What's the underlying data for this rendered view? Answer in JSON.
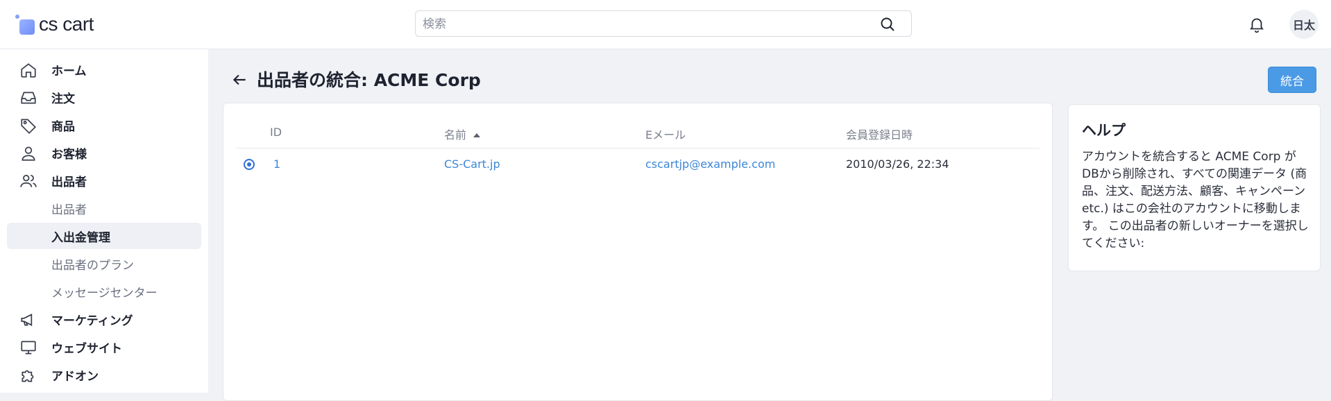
{
  "app": {
    "logo_text": "cs cart"
  },
  "search": {
    "placeholder": "検索"
  },
  "user": {
    "avatar_text": "日太"
  },
  "sidebar": {
    "items": [
      {
        "label": "ホーム",
        "icon": "home-icon"
      },
      {
        "label": "注文",
        "icon": "inbox-icon"
      },
      {
        "label": "商品",
        "icon": "tag-icon"
      },
      {
        "label": "お客様",
        "icon": "user-icon"
      },
      {
        "label": "出品者",
        "icon": "users-icon"
      }
    ],
    "subitems": [
      {
        "label": "出品者"
      },
      {
        "label": "入出金管理",
        "active": true
      },
      {
        "label": "出品者のプラン"
      },
      {
        "label": "メッセージセンター"
      }
    ],
    "items_after": [
      {
        "label": "マーケティング",
        "icon": "megaphone-icon"
      },
      {
        "label": "ウェブサイト",
        "icon": "monitor-icon"
      },
      {
        "label": "アドオン",
        "icon": "puzzle-icon"
      }
    ]
  },
  "page": {
    "title": "出品者の統合: ACME Corp",
    "merge_button": "統合"
  },
  "table": {
    "headers": {
      "id": "ID",
      "name": "名前",
      "email": "Eメール",
      "registered": "会員登録日時"
    },
    "rows": [
      {
        "id": "1",
        "name": "CS-Cart.jp",
        "email": "cscartjp@example.com",
        "registered": "2010/03/26, 22:34",
        "selected": true
      }
    ]
  },
  "help": {
    "title": "ヘルプ",
    "body": "アカウントを統合すると ACME Corp が DBから削除され、すべての関連データ (商品、注文、配送方法、顧客、キャンペーン etc.) はこの会社のアカウントに移動します。 この出品者の新しいオーナーを選択してください:"
  },
  "colors": {
    "accent": "#4a9ae6",
    "link": "#3a86d8",
    "radio": "#2f6fd6",
    "background": "#f0f2f6"
  }
}
